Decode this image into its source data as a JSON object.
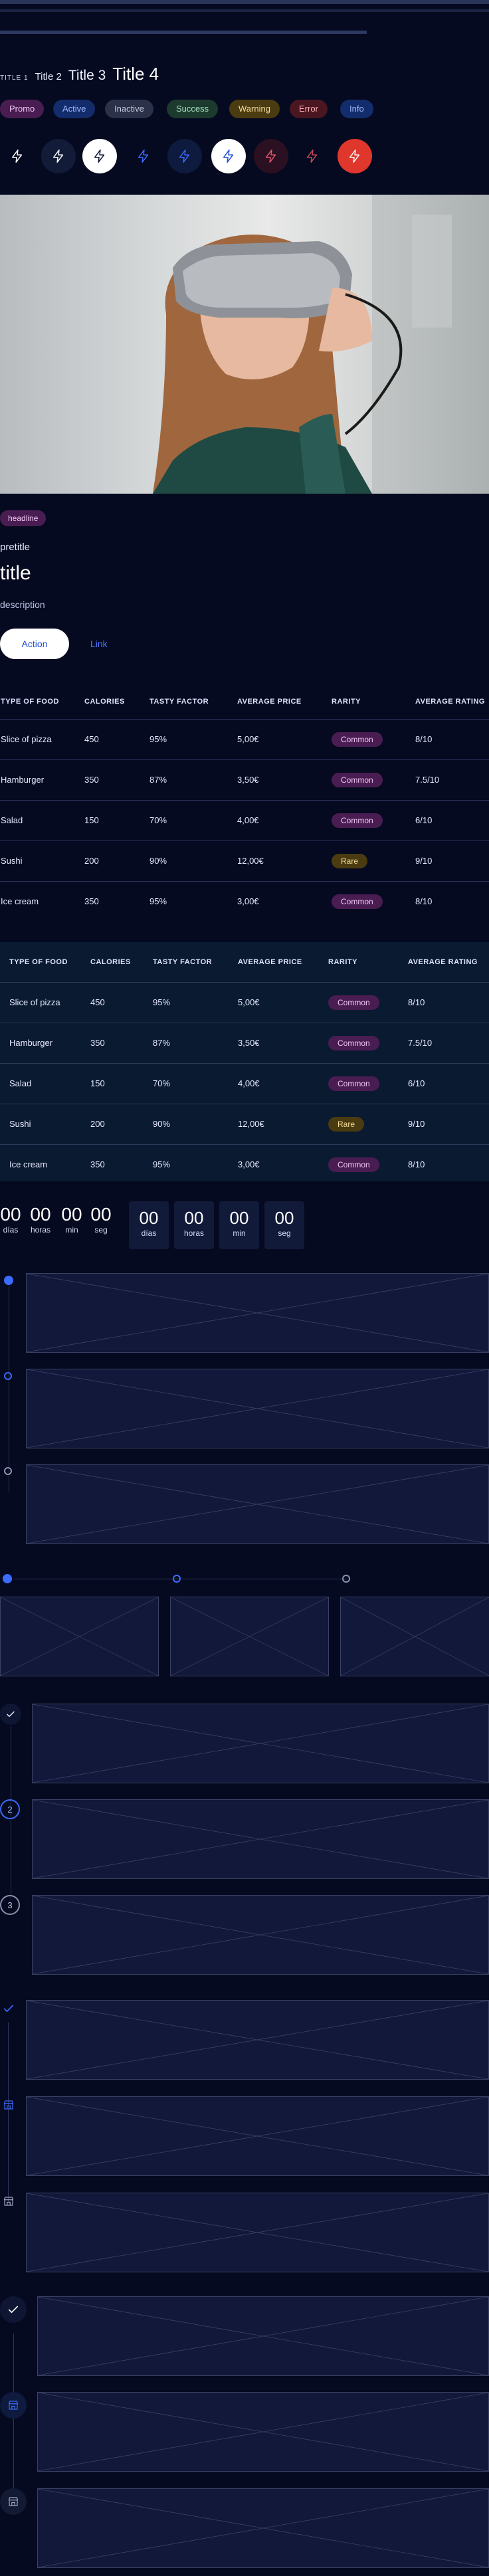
{
  "titles": {
    "t1": "TITLE 1",
    "t2": "Title 2",
    "t3": "Title 3",
    "t4": "Title 4"
  },
  "badges": [
    {
      "label": "Promo",
      "bg": "#4a1d52",
      "fg": "#f0c6f4"
    },
    {
      "label": "Active",
      "bg": "#132c6b",
      "fg": "#9fb8ff"
    },
    {
      "label": "Inactive",
      "bg": "#2a3148",
      "fg": "#c3c9dc"
    },
    {
      "label": "Success",
      "bg": "#1c3a2e",
      "fg": "#a8e0c0"
    },
    {
      "label": "Warning",
      "bg": "#4a3b10",
      "fg": "#f4dc9a"
    },
    {
      "label": "Error",
      "bg": "#4a1620",
      "fg": "#ffb0b8"
    },
    {
      "label": "Info",
      "bg": "#132c6b",
      "fg": "#9fb8ff"
    }
  ],
  "card": {
    "tag": "headline",
    "pretitle": "pretitle",
    "title": "title",
    "description": "description",
    "action": "Action",
    "link": "Link"
  },
  "table": {
    "headers": [
      "TYPE OF FOOD",
      "CALORIES",
      "TASTY FACTOR",
      "AVERAGE PRICE",
      "RARITY",
      "AVERAGE RATING"
    ],
    "rows": [
      [
        "Slice of pizza",
        "450",
        "95%",
        "5,00€",
        "Common",
        "8/10"
      ],
      [
        "Hamburger",
        "350",
        "87%",
        "3,50€",
        "Common",
        "7.5/10"
      ],
      [
        "Salad",
        "150",
        "70%",
        "4,00€",
        "Common",
        "6/10"
      ],
      [
        "Sushi",
        "200",
        "90%",
        "12,00€",
        "Rare",
        "9/10"
      ],
      [
        "Ice cream",
        "350",
        "95%",
        "3,00€",
        "Common",
        "8/10"
      ]
    ]
  },
  "countdown": {
    "values": [
      "00",
      "00",
      "00",
      "00"
    ],
    "labels": [
      "días",
      "horas",
      "min",
      "seg"
    ]
  }
}
